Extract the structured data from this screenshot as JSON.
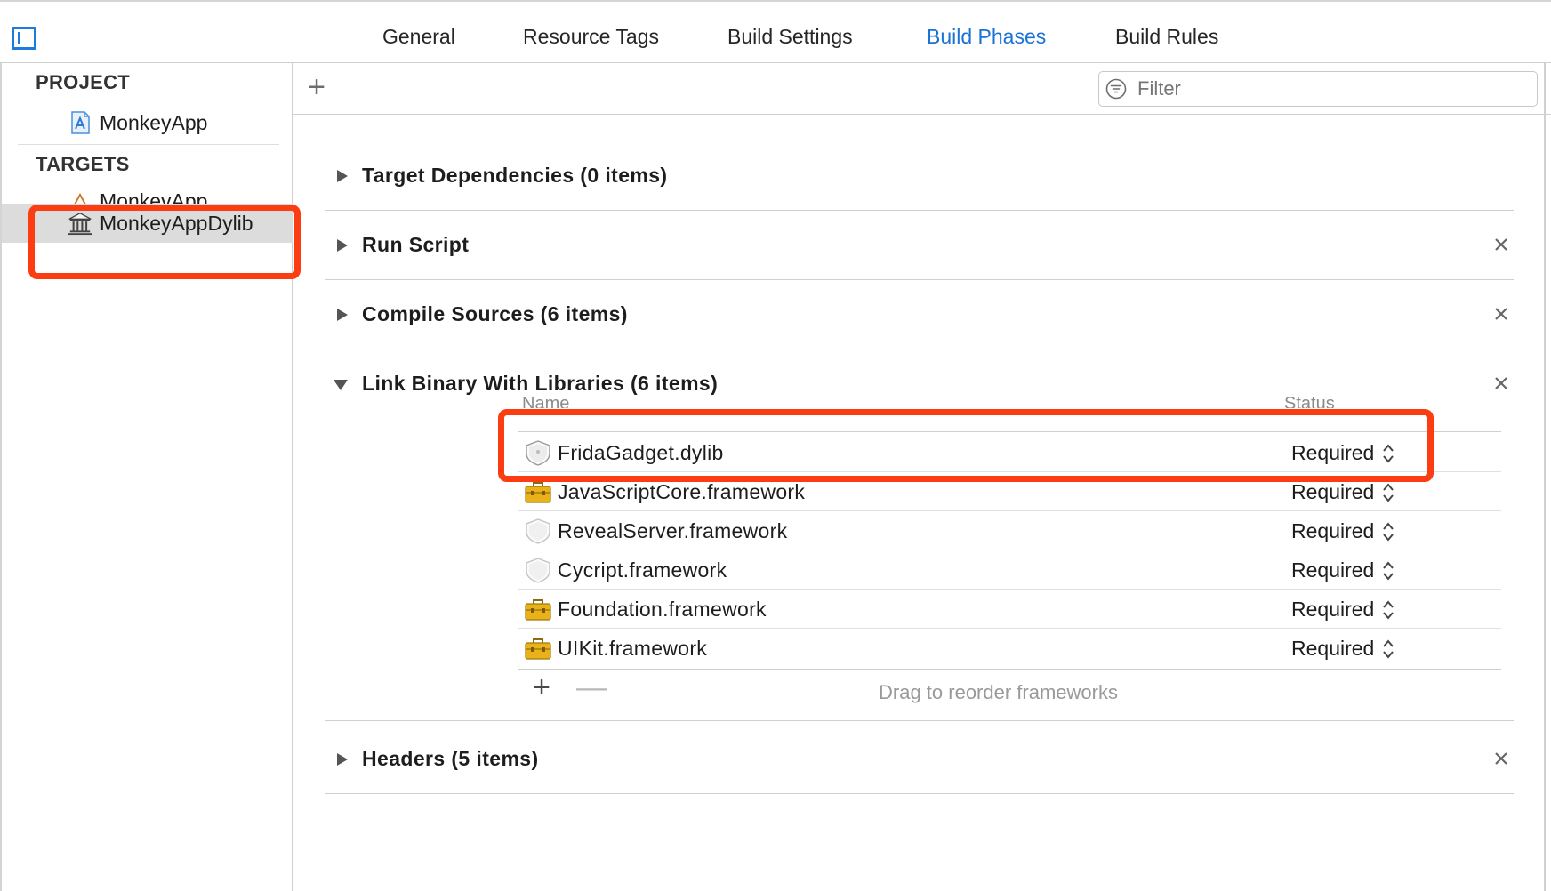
{
  "tabs": [
    {
      "label": "General",
      "active": false
    },
    {
      "label": "Resource Tags",
      "active": false
    },
    {
      "label": "Build Settings",
      "active": false
    },
    {
      "label": "Build Phases",
      "active": true
    },
    {
      "label": "Build Rules",
      "active": false
    }
  ],
  "sidebar": {
    "project_header": "PROJECT",
    "project_item": {
      "label": "MonkeyApp",
      "icon": "xcode-project-icon"
    },
    "targets_header": "TARGETS",
    "targets": [
      {
        "label": "MonkeyApp",
        "icon": "app-target-icon",
        "selected": false
      },
      {
        "label": "MonkeyAppDylib",
        "icon": "library-target-icon",
        "selected": true
      }
    ]
  },
  "toolbar": {
    "add_label": "+",
    "filter_placeholder": "Filter"
  },
  "phases": [
    {
      "title": "Target Dependencies (0 items)",
      "expanded": false,
      "closable": false
    },
    {
      "title": "Run Script",
      "expanded": false,
      "closable": true
    },
    {
      "title": "Compile Sources (6 items)",
      "expanded": false,
      "closable": true
    },
    {
      "title": "Link Binary With Libraries (6 items)",
      "expanded": true,
      "closable": true
    },
    {
      "title": "Headers (5 items)",
      "expanded": false,
      "closable": true
    }
  ],
  "libraries": {
    "columns": {
      "name": "Name",
      "status": "Status"
    },
    "rows": [
      {
        "name": "FridaGadget.dylib",
        "status": "Required",
        "icon": "dylib-shield-icon"
      },
      {
        "name": "JavaScriptCore.framework",
        "status": "Required",
        "icon": "toolbox-framework-icon"
      },
      {
        "name": "RevealServer.framework",
        "status": "Required",
        "icon": "shield-framework-icon"
      },
      {
        "name": "Cycript.framework",
        "status": "Required",
        "icon": "shield-framework-icon"
      },
      {
        "name": "Foundation.framework",
        "status": "Required",
        "icon": "toolbox-framework-icon"
      },
      {
        "name": "UIKit.framework",
        "status": "Required",
        "icon": "toolbox-framework-icon"
      }
    ],
    "add_label": "+",
    "remove_label": "—",
    "drag_hint": "Drag to reorder frameworks"
  },
  "colors": {
    "accent": "#1b73d6",
    "highlight": "#fb3d11",
    "selected_row": "#dcdcdc"
  }
}
